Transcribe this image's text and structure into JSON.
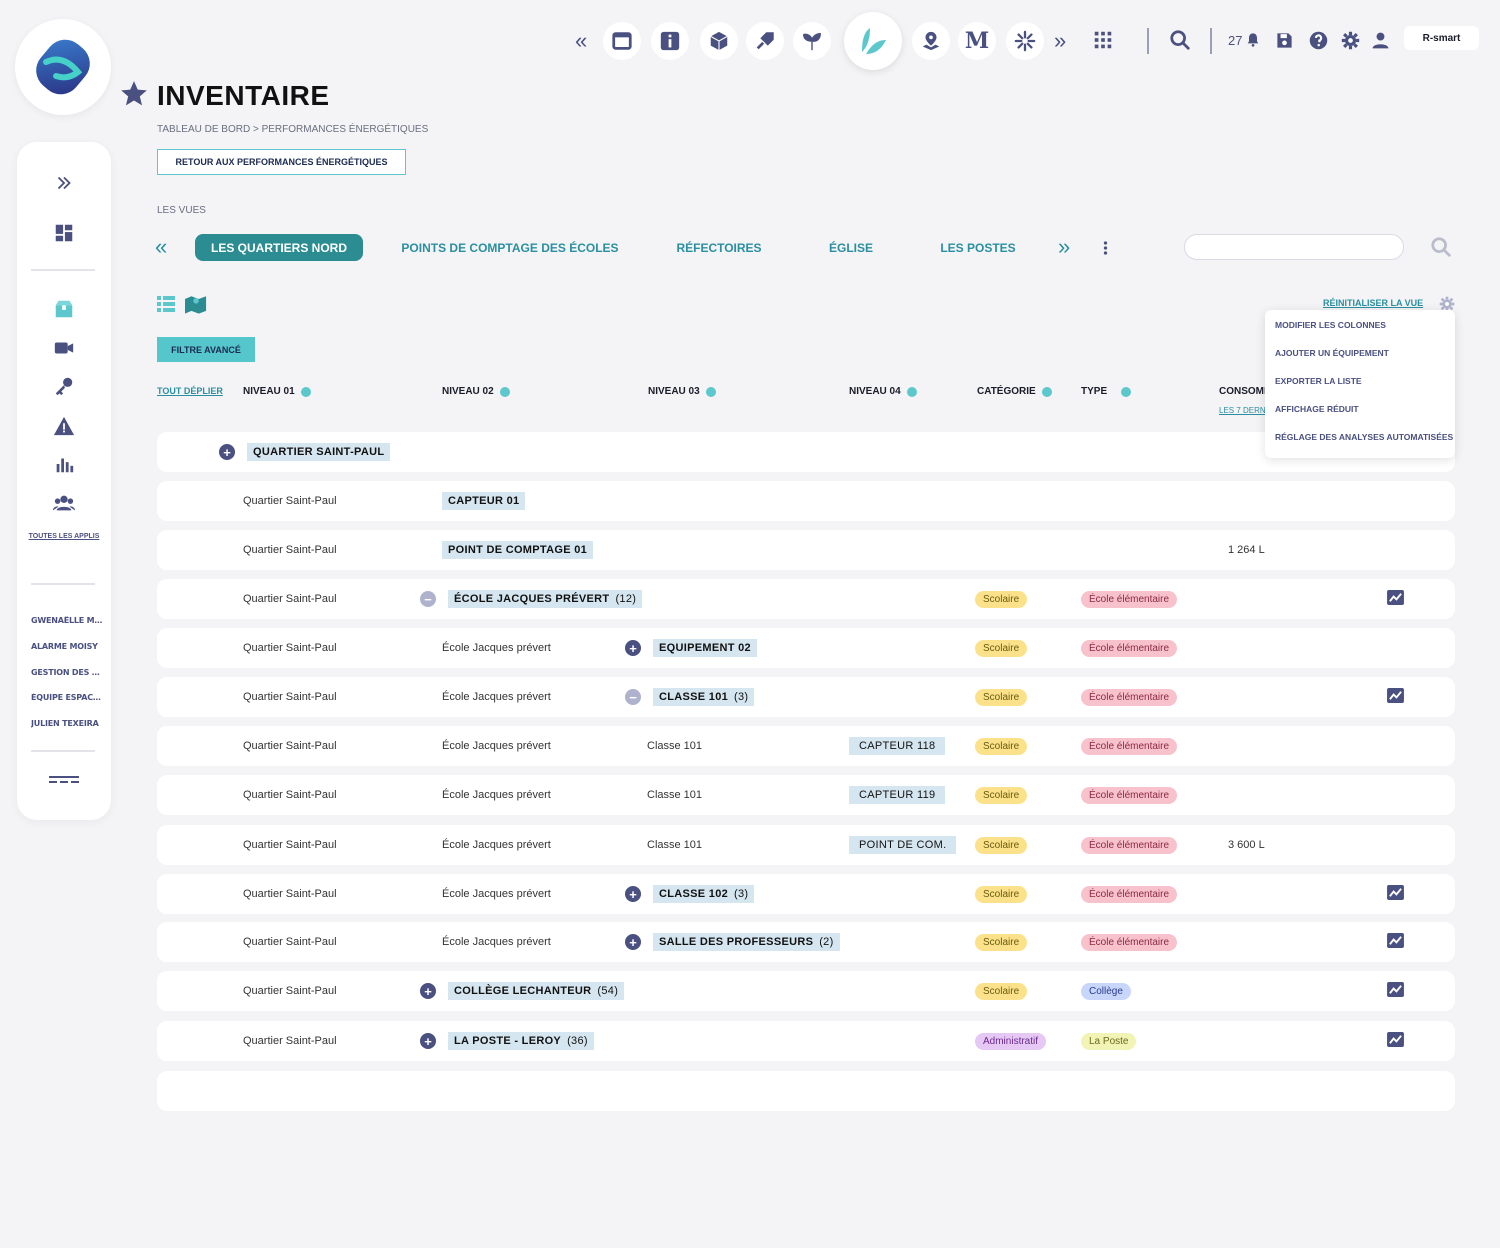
{
  "app": {
    "title": "INVENTAIRE",
    "breadcrumb": "TABLEAU DE BORD > PERFORMANCES ÉNERGÉTIQUES",
    "back_label": "RETOUR AUX PERFORMANCES ÉNERGÉTIQUES"
  },
  "topbar": {
    "notif_count": "27",
    "brand": "R-smart",
    "app_icons": [
      "window-icon",
      "info-icon",
      "box-icon",
      "cubes-icon",
      "sprout-icon",
      "leaf-app-icon",
      "location-icon",
      "m-icon",
      "asterisk-icon"
    ]
  },
  "sidebar": {
    "apps_label": "TOUTES LES APPLIS",
    "users": [
      "GWENAËLLE MA...",
      "ALARME MOISY",
      "GESTION DES RÔ...",
      "ÉQUIPE ESPACE ...",
      "JULIEN TEXEIRA"
    ]
  },
  "views": {
    "label": "LES VUES",
    "tabs": [
      "LES QUARTIERS NORD",
      "POINTS DE COMPTAGE DES ÉCOLES",
      "RÉFECTOIRES",
      "ÉGLISE",
      "LES POSTES"
    ],
    "active": 0
  },
  "toolbar": {
    "filter": "FILTRE AVANCÉ",
    "reset": "RÉINITIALISER LA VUE"
  },
  "menu": [
    "MODIFIER LES COLONNES",
    "AJOUTER UN ÉQUIPEMENT",
    "EXPORTER LA LISTE",
    "AFFICHAGE RÉDUIT",
    "RÉGLAGE DES ANALYSES AUTOMATISÉES"
  ],
  "table": {
    "expand_all": "TOUT DÉPLIER",
    "headers": [
      "NIVEAU 01",
      "NIVEAU 02",
      "NIVEAU 03",
      "NIVEAU 04",
      "CATÉGORIE",
      "TYPE",
      "CONSOMM"
    ],
    "consumption_sub": "LES 7 DERN",
    "rows": [
      {
        "n1": "QUARTIER SAINT-PAUL"
      },
      {
        "n1": "Quartier Saint-Paul",
        "n2": "CAPTEUR 01"
      },
      {
        "n1": "Quartier Saint-Paul",
        "n2": "POINT DE COMPTAGE 01",
        "conso": "1 264 L"
      },
      {
        "n1": "Quartier Saint-Paul",
        "n2": "ÉCOLE JACQUES PRÉVERT",
        "n2c": "(12)",
        "cat": "Scolaire",
        "type": "École élémentaire"
      },
      {
        "n1": "Quartier Saint-Paul",
        "n2": "École Jacques prévert",
        "n3": "EQUIPEMENT 02",
        "cat": "Scolaire",
        "type": "École élémentaire"
      },
      {
        "n1": "Quartier Saint-Paul",
        "n2": "École Jacques prévert",
        "n3": "CLASSE 101",
        "n3c": "(3)",
        "cat": "Scolaire",
        "type": "École élémentaire"
      },
      {
        "n1": "Quartier Saint-Paul",
        "n2": "École Jacques prévert",
        "n3": "Classe 101",
        "n4": "CAPTEUR 118",
        "cat": "Scolaire",
        "type": "École élémentaire"
      },
      {
        "n1": "Quartier Saint-Paul",
        "n2": "École Jacques prévert",
        "n3": "Classe 101",
        "n4": "CAPTEUR 119",
        "cat": "Scolaire",
        "type": "École élémentaire"
      },
      {
        "n1": "Quartier Saint-Paul",
        "n2": "École Jacques prévert",
        "n3": "Classe 101",
        "n4": "POINT DE COM.",
        "cat": "Scolaire",
        "type": "École élémentaire",
        "conso": "3 600 L"
      },
      {
        "n1": "Quartier Saint-Paul",
        "n2": "École Jacques prévert",
        "n3": "CLASSE 102",
        "n3c": "(3)",
        "cat": "Scolaire",
        "type": "École élémentaire"
      },
      {
        "n1": "Quartier Saint-Paul",
        "n2": "École Jacques prévert",
        "n3": "SALLE DES PROFESSEURS",
        "n3c": "(2)",
        "cat": "Scolaire",
        "type": "École élémentaire"
      },
      {
        "n1": "Quartier Saint-Paul",
        "n2": "COLLÈGE LECHANTEUR",
        "n2c": "(54)",
        "cat": "Scolaire",
        "type": "Collège"
      },
      {
        "n1": "Quartier Saint-Paul",
        "n2": "LA POSTE - LEROY",
        "n2c": "(36)",
        "cat": "Administratif",
        "type": "La Poste"
      }
    ]
  },
  "colors": {
    "accent": "#2b8c91",
    "teal": "#55c7cc",
    "navy": "#4a5080"
  }
}
